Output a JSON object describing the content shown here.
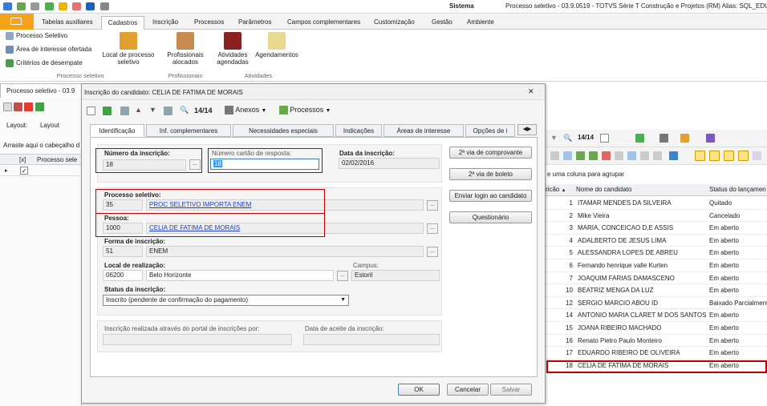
{
  "titlebar": {
    "app_label": "Sistema",
    "title": "Processo seletivo - 03.9.0519 - TOTVS Série T Construção e Projetos (RM) Alias: SQL_EDU"
  },
  "menu": {
    "tabs": [
      "Tabelas auxiliares",
      "Cadastros",
      "Inscrição",
      "Processos",
      "Parâmetros",
      "Campos complementares",
      "Customização",
      "Gestão",
      "Ambiente"
    ],
    "active": "Cadastros"
  },
  "ribbon": {
    "processo_items": [
      "Processo Seletivo",
      "Área de interesse ofertada",
      "Critérios de desempate"
    ],
    "local_label": "Local de processo seletivo",
    "prof_label": "Profissionais alocados",
    "atividades_label": "Atividades agendadas",
    "agendamentos_label": "Agendamentos",
    "groups": [
      "Processo seletivo",
      "Profissionais",
      "Atividades"
    ]
  },
  "doc_tab": "Processo seletivo - 03.9",
  "left_panel": {
    "layout_label": "Layout:",
    "layout_btn": "Layout",
    "drag_hint": "Arraste aqui o cabeçalho d",
    "col_x": "[x]",
    "col_name": "Processo sele"
  },
  "dialog": {
    "title": "Inscrição do candidato: CELIA DE FATIMA DE MORAIS",
    "close": "✕",
    "nav_count": "14/14",
    "anexos": "Anexos",
    "processos": "Processos",
    "tabs": [
      "Identificação",
      "Inf. complementares",
      "Necessidades especiais",
      "Indicações",
      "Áreas de interesse",
      "Opções de i"
    ],
    "numero_inscricao_label": "Número da inscrição:",
    "numero_inscricao": "18",
    "numero_cartao_label": "Número cartão de resposta:",
    "numero_cartao": "18",
    "data_inscricao_label": "Data da inscrição:",
    "data_inscricao": "02/02/2016",
    "processo_label": "Processo seletivo:",
    "processo_code": "35",
    "processo_name": "PROC SELETIVO IMPORTA ENEM",
    "pessoa_label": "Pessoa:",
    "pessoa_code": "1000",
    "pessoa_name": "CELIA DE FATIMA DE MORAIS",
    "forma_label": "Forma de inscrição:",
    "forma_code": "51",
    "forma_name": "ENEM",
    "local_label": "Local de realização:",
    "local_code": "06200",
    "local_name": "Belo Horizonte",
    "campus_label": "Campus:",
    "campus_value": "Estoril",
    "status_label": "Status da inscrição:",
    "status_value": "Inscrito (pendente de confirmação do pagamento)",
    "portal_label": "Inscrição realizada através do portal de inscrições por:",
    "aceite_label": "Data de aceite da inscrição:",
    "side_buttons": [
      "2ª via de comprovante",
      "2ª via de boleto",
      "Enviar login ao candidato",
      "Questionário"
    ],
    "ok": "OK",
    "cancel": "Cancelar",
    "save": "Salvar"
  },
  "grid": {
    "nav_count": "14/14",
    "group_hint": "e uma coluna para agrupar",
    "headers": [
      "ricão",
      "Nome do candidato",
      "Status do lançamen"
    ],
    "rows": [
      {
        "num": "1",
        "name": "ITAMAR MENDES DA SILVEIRA",
        "status": "Quitado"
      },
      {
        "num": "2",
        "name": "Mike Vieira",
        "status": "Cancelado"
      },
      {
        "num": "3",
        "name": "MARIA, CONCEICAO D,E ASSIS",
        "status": "Em aberto"
      },
      {
        "num": "4",
        "name": "ADALBERTO DE JESUS LIMA",
        "status": "Em aberto"
      },
      {
        "num": "5",
        "name": "ALESSANDRA LOPES DE ABREU",
        "status": "Em aberto"
      },
      {
        "num": "6",
        "name": "Fernando henrique valle Kurten",
        "status": "Em aberto"
      },
      {
        "num": "7",
        "name": "JOAQUIM FARIAS DAMASCENO",
        "status": "Em aberto"
      },
      {
        "num": "10",
        "name": "BEATRIZ MENGA DA LUZ",
        "status": "Em aberto"
      },
      {
        "num": "12",
        "name": "SERGIO MARCIO ABOU ID",
        "status": "Baixado Parcialment"
      },
      {
        "num": "14",
        "name": "ANTONIO MARIA CLARET M DOS SANTOS",
        "status": "Em aberto"
      },
      {
        "num": "15",
        "name": "JOANA RIBEIRO MACHADO",
        "status": "Em aberto"
      },
      {
        "num": "16",
        "name": "Renato Pietro Paulo Monteiro",
        "status": "Em aberto"
      },
      {
        "num": "17",
        "name": "EDUARDO RIBEIRO DE OLIVEIRA",
        "status": "Em aberto"
      },
      {
        "num": "18",
        "name": "CELIA DE FATIMA DE MORAIS",
        "status": "Em aberto"
      }
    ]
  }
}
